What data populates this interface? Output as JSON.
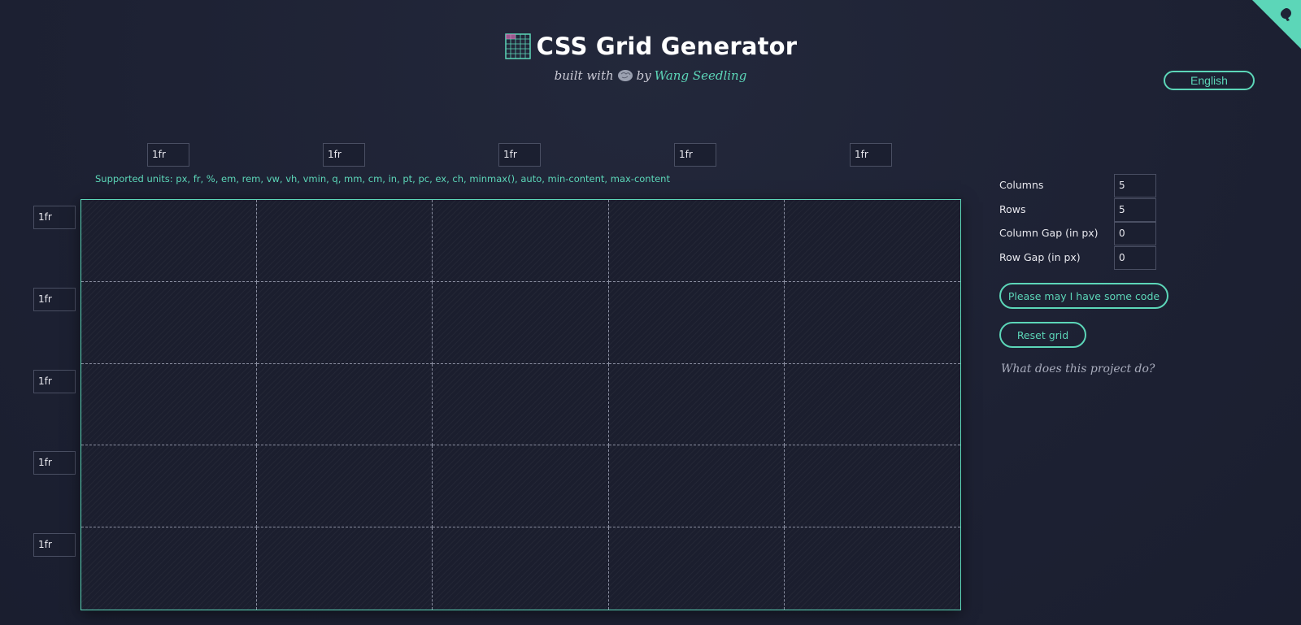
{
  "header": {
    "title": "CSS Grid Generator",
    "subtitle_prefix": "built with",
    "subtitle_by": "by",
    "author": "Wang Seedling",
    "title_icon": "grid-icon",
    "subtitle_icon": "brain-icon"
  },
  "language": {
    "label": "English"
  },
  "columns_inputs": [
    "1fr",
    "1fr",
    "1fr",
    "1fr",
    "1fr"
  ],
  "rows_inputs": [
    "1fr",
    "1fr",
    "1fr",
    "1fr",
    "1fr"
  ],
  "units_note": "Supported units: px, fr, %, em, rem, vw, vh, vmin, q, mm, cm, in, pt, pc, ex, ch, minmax(), auto, min-content, max-content",
  "controls": {
    "columns": {
      "label": "Columns",
      "value": "5"
    },
    "rows": {
      "label": "Rows",
      "value": "5"
    },
    "column_gap": {
      "label": "Column Gap (in px)",
      "value": "0"
    },
    "row_gap": {
      "label": "Row Gap (in px)",
      "value": "0"
    }
  },
  "buttons": {
    "code": "Please may I have some code",
    "reset": "Reset grid"
  },
  "about_link": "What does this project do?",
  "colors": {
    "accent": "#5cd6b8",
    "background": "#1f2336"
  }
}
